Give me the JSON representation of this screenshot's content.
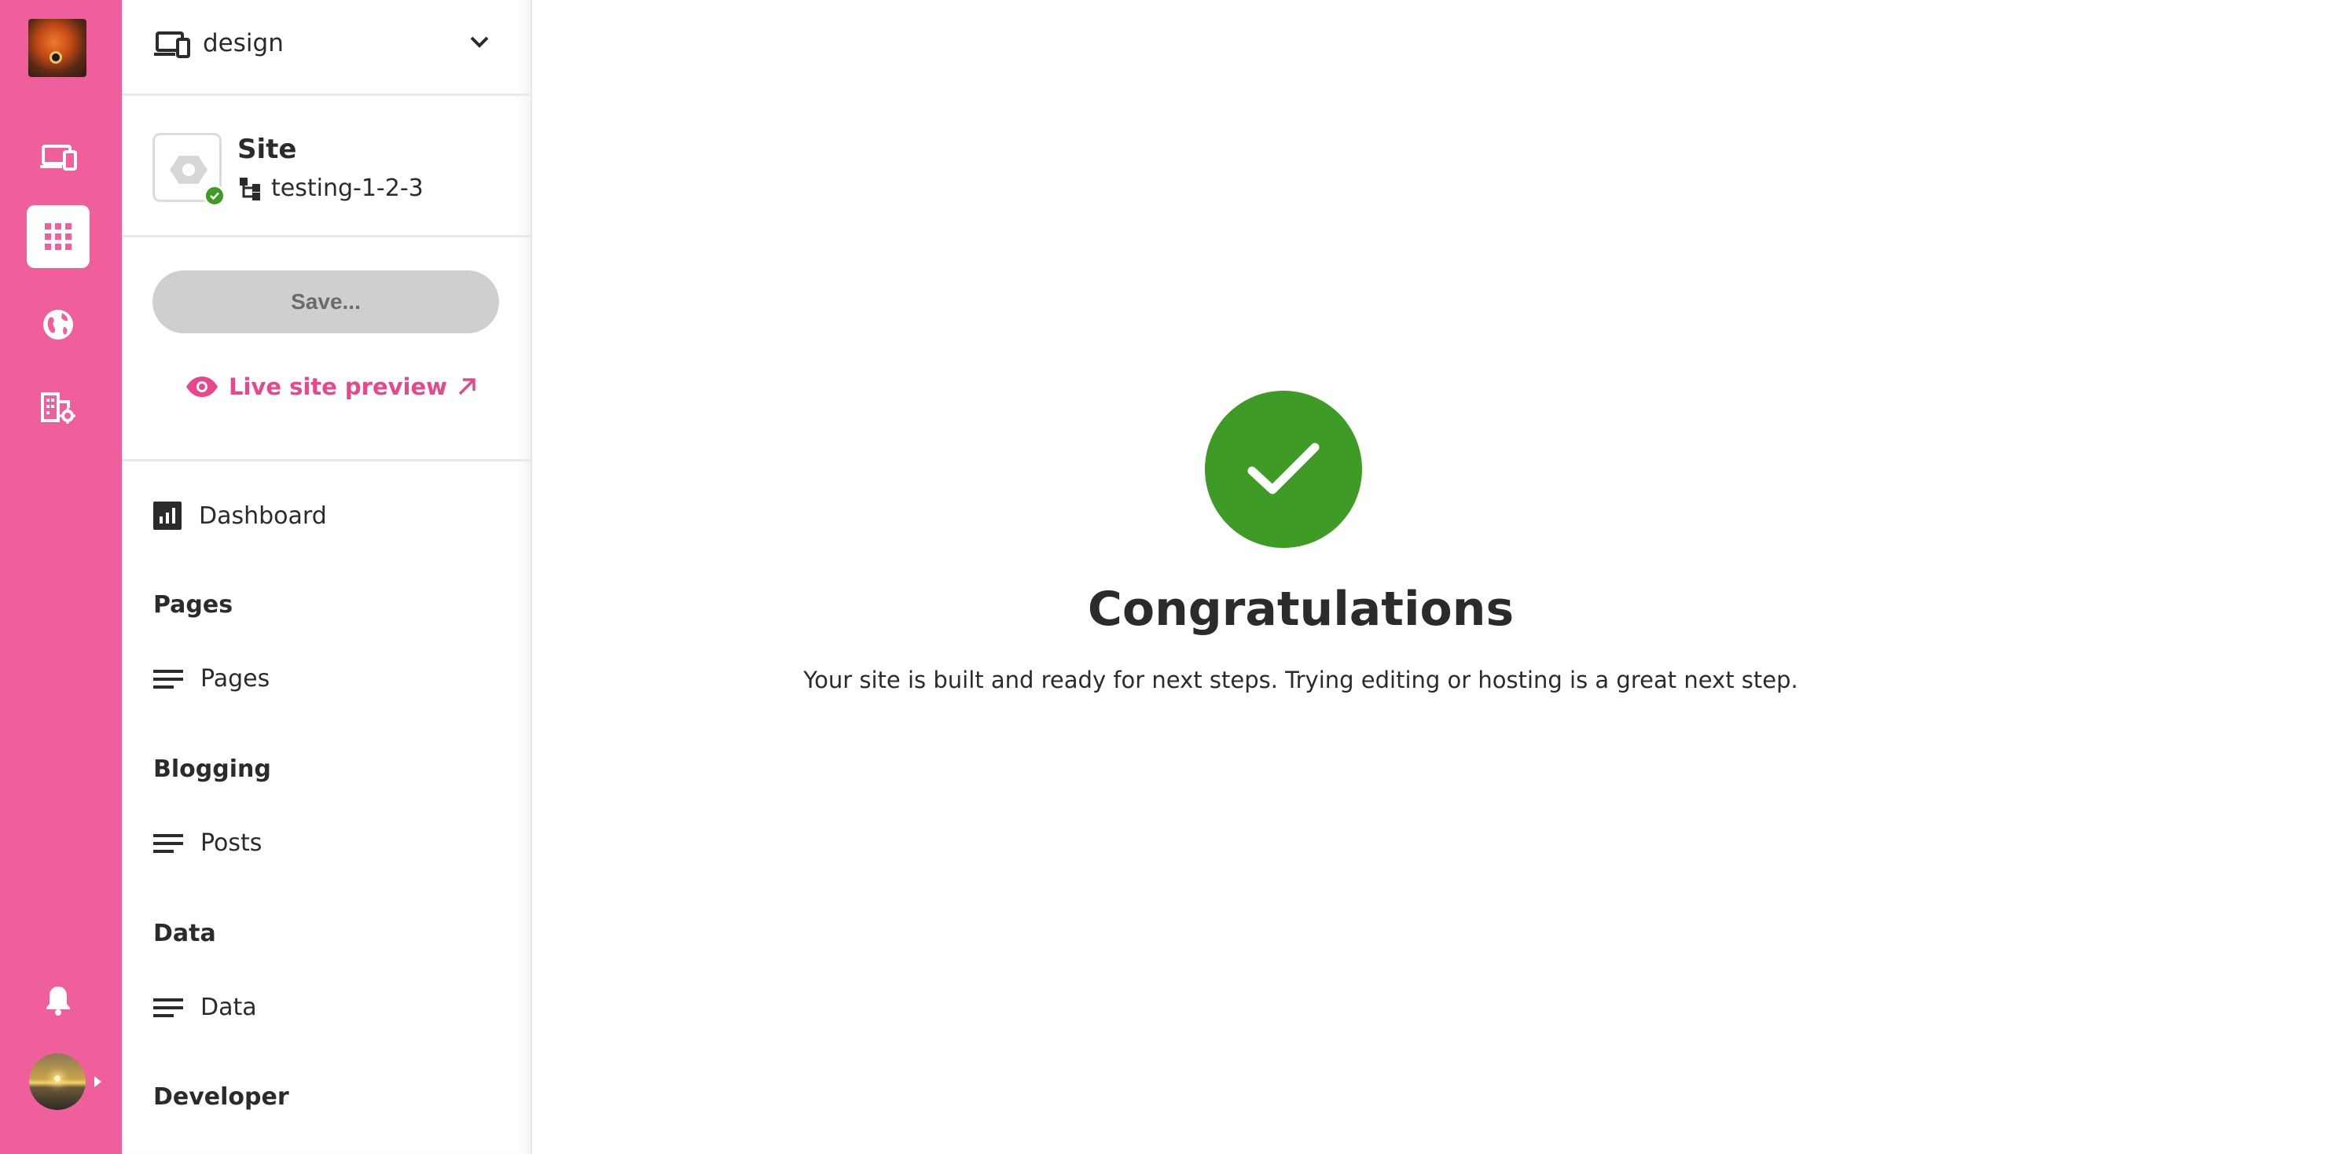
{
  "app": {
    "brand_color": "#ef5f9c",
    "accent_text_color": "#e8478b",
    "success_color": "#3e9b25"
  },
  "rail": {
    "items": [
      {
        "icon": "devices-icon"
      },
      {
        "icon": "apps-grid-icon",
        "active": true
      },
      {
        "icon": "globe-icon"
      },
      {
        "icon": "building-gear-icon"
      }
    ],
    "bottom": {
      "icon": "bell-icon"
    }
  },
  "project_selector": {
    "icon": "devices-icon",
    "name": "design"
  },
  "site": {
    "title": "Site",
    "branch": "testing-1-2-3",
    "status_icon": "check-icon"
  },
  "actions": {
    "save_label": "Save...",
    "preview_label": "Live site preview"
  },
  "nav": {
    "dashboard": "Dashboard",
    "sections": [
      {
        "heading": "Pages",
        "item": "Pages"
      },
      {
        "heading": "Blogging",
        "item": "Posts"
      },
      {
        "heading": "Data",
        "item": "Data"
      },
      {
        "heading": "Developer"
      }
    ]
  },
  "main": {
    "title": "Congratulations",
    "message": "Your site is built and ready for next steps. Trying editing or hosting is a great next step."
  }
}
